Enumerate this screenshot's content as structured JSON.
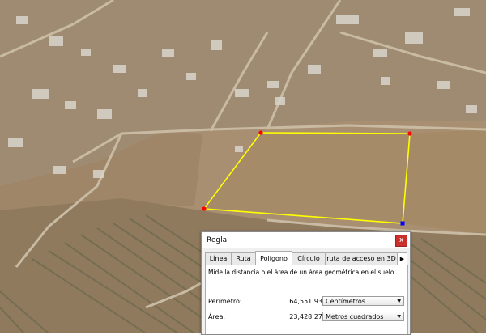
{
  "dialog": {
    "title": "Regla",
    "close_glyph": "x",
    "tabs": [
      {
        "label": "Línea",
        "active": false
      },
      {
        "label": "Ruta",
        "active": false
      },
      {
        "label": "Polígono",
        "active": true
      },
      {
        "label": "Círculo",
        "active": false
      },
      {
        "label": "ruta de acceso en 3D",
        "active": false
      }
    ],
    "tab_scroll_glyph": "▶",
    "description": "Mide la distancia o el área de un área geométrica en el suelo.",
    "perimeter": {
      "label": "Perímetro:",
      "value": "64,551.93",
      "unit": "Centímetros"
    },
    "area": {
      "label": "Área:",
      "value": "23,428.27",
      "unit": "Metros cuadrados"
    },
    "dropdown_glyph": "▼"
  },
  "polygon": {
    "outline_color": "#ffff00",
    "vertex_color": "#ff0000",
    "active_vertex_color": "#0000ff"
  }
}
